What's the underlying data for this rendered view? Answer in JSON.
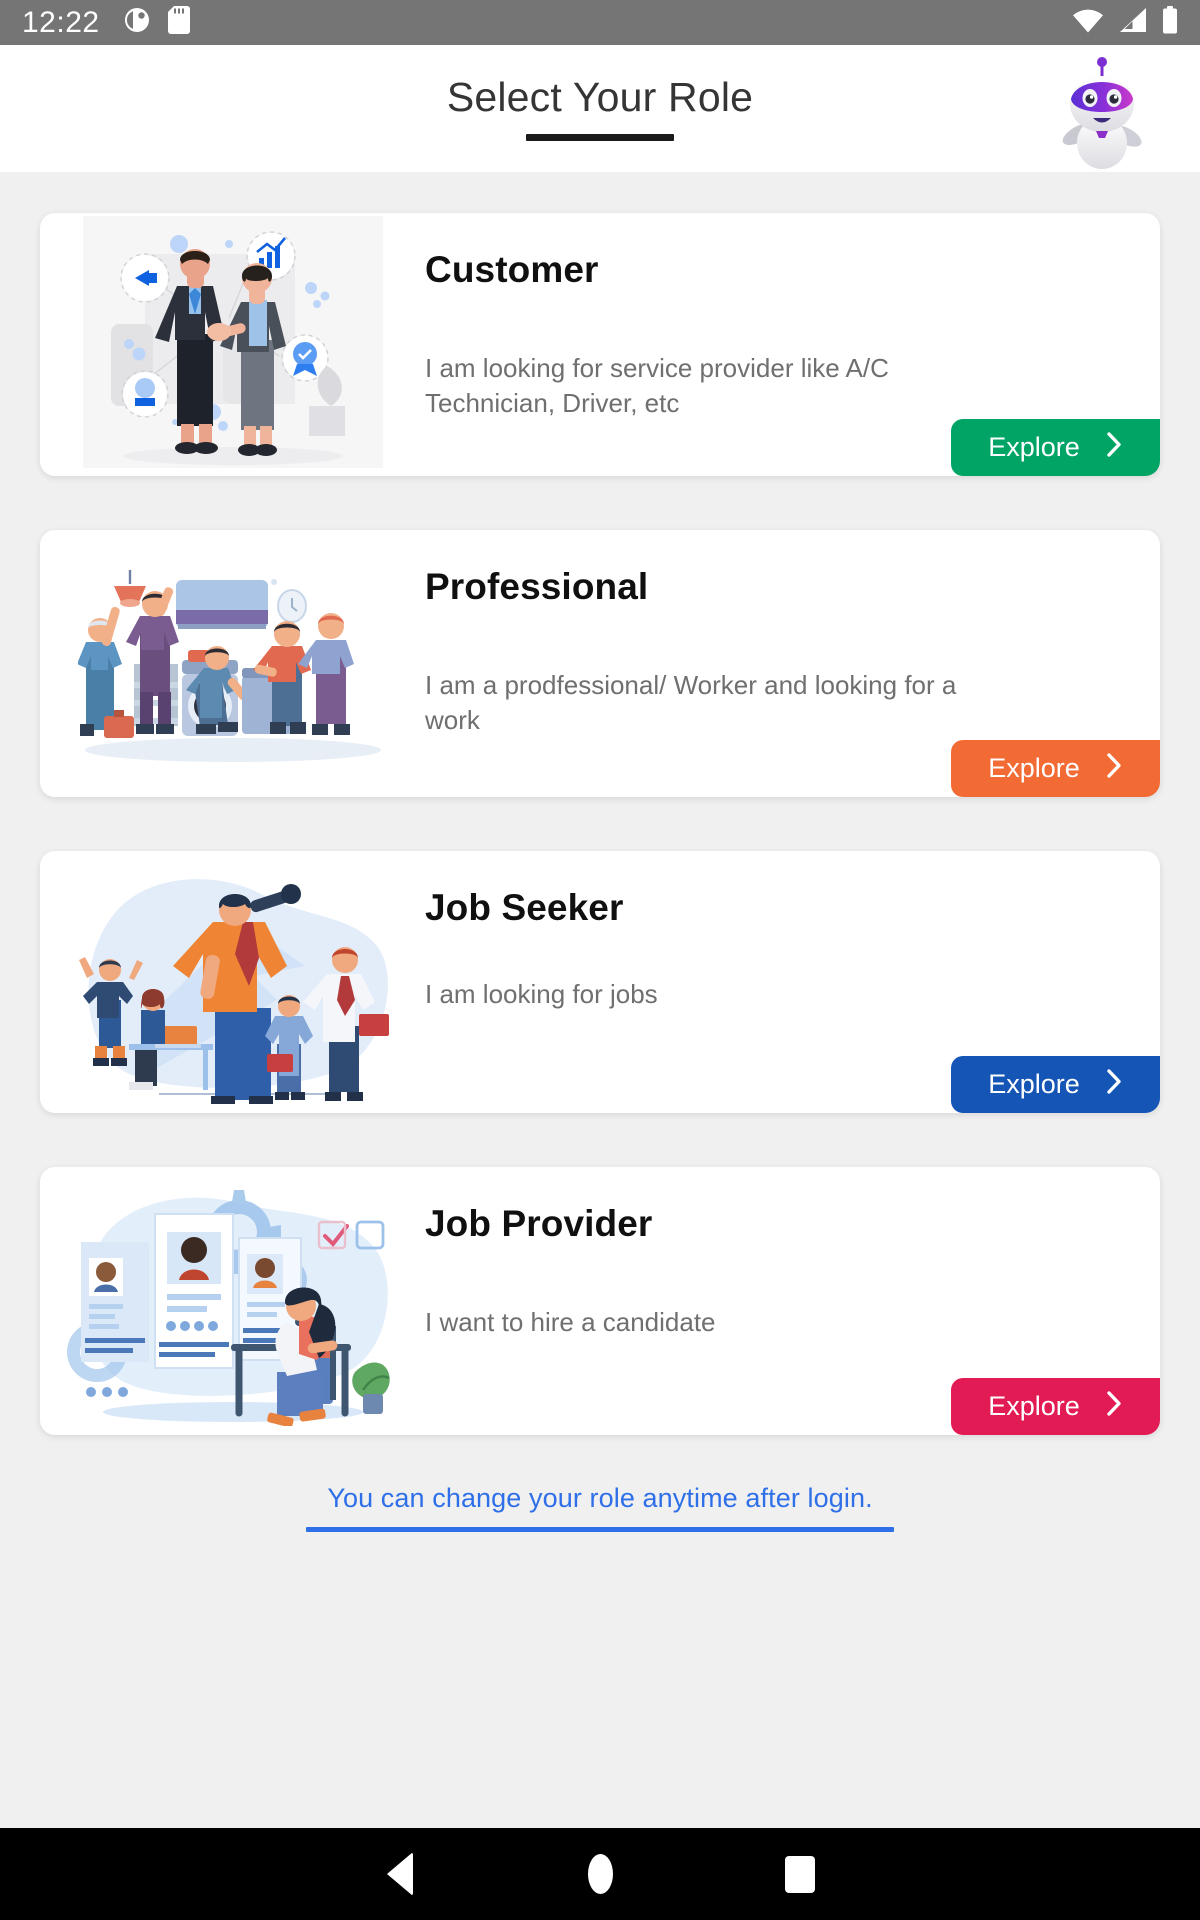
{
  "status_bar": {
    "time": "12:22",
    "left_icons": [
      "screen-record-icon",
      "sd-card-icon"
    ],
    "right_icons": [
      "wifi-icon",
      "cellular-signal-icon",
      "battery-icon"
    ],
    "background": "#757575"
  },
  "header": {
    "title": "Select Your Role",
    "mascot": "chatbot-robot-icon",
    "underline_color": "#1b1b1b"
  },
  "roles": [
    {
      "title": "Customer",
      "description": "I am looking for service provider like A/C Technician, Driver, etc",
      "button_label": "Explore",
      "button_color": "#00a566",
      "illustration": "handshake-business-deal-illustration"
    },
    {
      "title": "Professional",
      "description": "I am a prodfessional/ Worker and looking for a work",
      "button_label": "Explore",
      "button_color": "#f26a34",
      "illustration": "repair-technicians-team-illustration"
    },
    {
      "title": "Job Seeker",
      "description": "I am looking for jobs",
      "button_label": "Explore",
      "button_color": "#1455b5",
      "illustration": "job-search-telescope-illustration"
    },
    {
      "title": "Job Provider",
      "description": "I want to hire a candidate",
      "button_label": "Explore",
      "button_color": "#e31b54",
      "illustration": "recruiter-resume-screening-illustration"
    }
  ],
  "footer": {
    "note": "You can change your role anytime after login.",
    "color": "#2f6fe8"
  },
  "navigation_bar": {
    "back": "back-triangle-icon",
    "home": "home-circle-icon",
    "recents": "recents-square-icon"
  }
}
